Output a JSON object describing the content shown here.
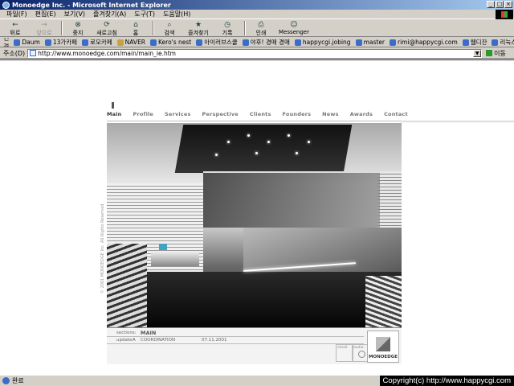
{
  "window": {
    "title": "Monoedge Inc. - Microsoft Internet Explorer",
    "buttons": [
      "_",
      "□",
      "×"
    ]
  },
  "menu": [
    "파일(F)",
    "편집(E)",
    "보기(V)",
    "즐겨찾기(A)",
    "도구(T)",
    "도움말(H)"
  ],
  "toolbar": [
    {
      "label": "뒤로",
      "icon": "back-arrow-icon",
      "glyph": "←",
      "enabled": true
    },
    {
      "label": "앞으로",
      "icon": "forward-arrow-icon",
      "glyph": "→",
      "enabled": false
    },
    {
      "label": "중지",
      "icon": "stop-icon",
      "glyph": "⊗",
      "enabled": true
    },
    {
      "label": "새로고침",
      "icon": "refresh-icon",
      "glyph": "⟳",
      "enabled": true
    },
    {
      "label": "홈",
      "icon": "home-icon",
      "glyph": "⌂",
      "enabled": true
    },
    {
      "label": "검색",
      "icon": "search-icon",
      "glyph": "⌕",
      "enabled": true
    },
    {
      "label": "즐겨찾기",
      "icon": "favorites-icon",
      "glyph": "★",
      "enabled": true
    },
    {
      "label": "기록",
      "icon": "history-icon",
      "glyph": "◷",
      "enabled": true
    },
    {
      "label": "인쇄",
      "icon": "print-icon",
      "glyph": "⎙",
      "enabled": true
    },
    {
      "label": "Messenger",
      "icon": "messenger-icon",
      "glyph": "☺",
      "enabled": true
    }
  ],
  "links": {
    "label": "연결",
    "items": [
      "Daum",
      "13가카페",
      "로모카페",
      "NAVER",
      "Kero's nest",
      "아이러브스쿨",
      "야후! 경매 경매",
      "happycgi.jobing",
      "master",
      "rimi@happycgi.com",
      "웹디잔",
      "리눅스"
    ]
  },
  "address": {
    "label": "주소(D)",
    "url": "http://www.monoedge.com/main/main_ie.htm",
    "go_label": "이동"
  },
  "site": {
    "nav": [
      "Main",
      "Profile",
      "Services",
      "Perspective",
      "Clients",
      "Founders",
      "News",
      "Awards",
      "Contact"
    ],
    "render_copyright": "© 2001 MONOEDGE Inc. All Rights Reserved",
    "info": {
      "sections_label": "sections:",
      "sections_value": "MAIN",
      "update_label": "update:",
      "update_marker": "A",
      "update_value": "COORDINATION",
      "date": "07.11.2001",
      "email_label": "email:",
      "audio_label": "audio:",
      "logo_text": "MONOEDGE"
    }
  },
  "status": {
    "text": "완료",
    "copyright": "Copyright(c) http://www.happycgi.com"
  }
}
